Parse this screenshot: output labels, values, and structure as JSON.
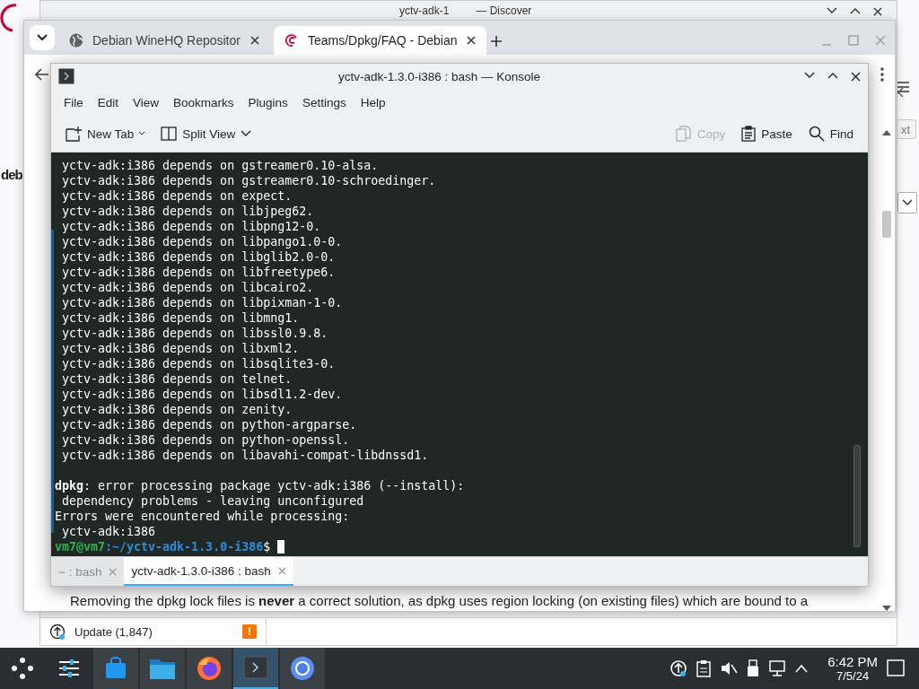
{
  "firefox_window": {
    "logo_text": "deb",
    "button_fragment": "xt"
  },
  "discover_window": {
    "title_start": "yctv-adk-1",
    "title_end": "— Discover",
    "status": {
      "label": "Update (1,847)",
      "badge": "!"
    }
  },
  "browser": {
    "tabs": [
      {
        "title": "Debian WineHQ Repositor",
        "selected": false
      },
      {
        "title": "Teams/Dpkg/FAQ - Debian",
        "selected": true
      }
    ],
    "page_text": "Removing the dpkg lock files is **never** a correct solution, as dpkg uses region locking (on existing files) which are bound to a"
  },
  "konsole": {
    "title": "yctv-adk-1.3.0-i386 : bash — Konsole",
    "menu": [
      "File",
      "Edit",
      "View",
      "Bookmarks",
      "Plugins",
      "Settings",
      "Help"
    ],
    "toolbar": [
      {
        "label": "New Tab",
        "kind": "corner-menu",
        "disabled": false
      },
      {
        "label": "Split View",
        "kind": "dropdown",
        "disabled": false
      },
      {
        "label": "Copy",
        "kind": "plain",
        "disabled": true
      },
      {
        "label": "Paste",
        "kind": "plain",
        "disabled": false
      },
      {
        "label": "Find",
        "kind": "plain",
        "disabled": false
      }
    ],
    "terminal": {
      "lines": [
        {
          "kind": "text",
          "text": " yctv-adk:i386 depends on gstreamer0.10-alsa."
        },
        {
          "kind": "text",
          "text": " yctv-adk:i386 depends on gstreamer0.10-schroedinger."
        },
        {
          "kind": "text",
          "text": " yctv-adk:i386 depends on expect."
        },
        {
          "kind": "text",
          "text": " yctv-adk:i386 depends on libjpeg62."
        },
        {
          "kind": "text",
          "text": " yctv-adk:i386 depends on libpng12-0."
        },
        {
          "kind": "text",
          "text": " yctv-adk:i386 depends on libpango1.0-0."
        },
        {
          "kind": "text",
          "text": " yctv-adk:i386 depends on libglib2.0-0."
        },
        {
          "kind": "text",
          "text": " yctv-adk:i386 depends on libfreetype6."
        },
        {
          "kind": "text",
          "text": " yctv-adk:i386 depends on libcairo2."
        },
        {
          "kind": "text",
          "text": " yctv-adk:i386 depends on libpixman-1-0."
        },
        {
          "kind": "text",
          "text": " yctv-adk:i386 depends on libmng1."
        },
        {
          "kind": "text",
          "text": " yctv-adk:i386 depends on libssl0.9.8."
        },
        {
          "kind": "text",
          "text": " yctv-adk:i386 depends on libxml2."
        },
        {
          "kind": "text",
          "text": " yctv-adk:i386 depends on libsqlite3-0."
        },
        {
          "kind": "text",
          "text": " yctv-adk:i386 depends on telnet."
        },
        {
          "kind": "text",
          "text": " yctv-adk:i386 depends on libsdl1.2-dev."
        },
        {
          "kind": "text",
          "text": " yctv-adk:i386 depends on zenity."
        },
        {
          "kind": "text",
          "text": " yctv-adk:i386 depends on python-argparse."
        },
        {
          "kind": "text",
          "text": " yctv-adk:i386 depends on python-openssl."
        },
        {
          "kind": "text",
          "text": " yctv-adk:i386 depends on libavahi-compat-libdnssd1."
        },
        {
          "kind": "blank"
        },
        {
          "kind": "text",
          "text": "**dpkg**: error processing package yctv-adk:i386 (--install):"
        },
        {
          "kind": "text",
          "text": " dependency problems - leaving unconfigured"
        },
        {
          "kind": "text",
          "text": "Errors were encountered while processing:"
        },
        {
          "kind": "text",
          "text": " yctv-adk:i386"
        },
        {
          "kind": "prompt",
          "user": "vm7@vm7",
          "path": ":~/yctv-adk-1.3.0-i386",
          "symbol": "$"
        }
      ]
    },
    "tabs": [
      {
        "label": "~ : bash",
        "selected": false
      },
      {
        "label": "yctv-adk-1.3.0-i386 : bash",
        "selected": true
      }
    ]
  },
  "taskbar": {
    "apps": [
      {
        "kind": "settings",
        "running": false,
        "selected": false
      },
      {
        "kind": "store",
        "running": true,
        "selected": false
      },
      {
        "kind": "files",
        "running": true,
        "selected": false
      },
      {
        "kind": "browser-fox",
        "running": true,
        "selected": false
      },
      {
        "kind": "terminal",
        "running": true,
        "selected": true
      },
      {
        "kind": "browser-circle",
        "running": true,
        "selected": false
      }
    ],
    "clock": {
      "time": "6:42 PM",
      "date": "7/5/24"
    }
  }
}
